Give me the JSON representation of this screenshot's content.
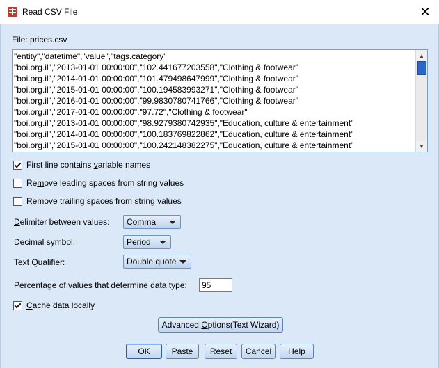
{
  "window": {
    "title": "Read CSV File",
    "close_glyph": "✕"
  },
  "file": {
    "label": "File: prices.csv"
  },
  "preview_lines": [
    "\"entity\",\"datetime\",\"value\",\"tags.category\"",
    "\"boi.org.il\",\"2013-01-01 00:00:00\",\"102.441677203558\",\"Clothing & footwear\"",
    "\"boi.org.il\",\"2014-01-01 00:00:00\",\"101.479498647999\",\"Clothing & footwear\"",
    "\"boi.org.il\",\"2015-01-01 00:00:00\",\"100.194583993271\",\"Clothing & footwear\"",
    "\"boi.org.il\",\"2016-01-01 00:00:00\",\"99.9830780741766\",\"Clothing & footwear\"",
    "\"boi.org.il\",\"2017-01-01 00:00:00\",\"97.72\",\"Clothing & footwear\"",
    "\"boi.org.il\",\"2013-01-01 00:00:00\",\"98.9279380742935\",\"Education, culture & entertainment\"",
    "\"boi.org.il\",\"2014-01-01 00:00:00\",\"100.183769822862\",\"Education, culture & entertainment\"",
    "\"boi.org.il\",\"2015-01-01 00:00:00\",\"100.242148382275\",\"Education, culture & entertainment\""
  ],
  "options": {
    "first_line_names": {
      "label_pre": "First line contains ",
      "label_u": "v",
      "label_post": "ariable names",
      "checked": true
    },
    "remove_leading": {
      "label_pre": "Re",
      "label_u": "m",
      "label_post": "ove leading spaces from string values",
      "checked": false
    },
    "remove_trailing": {
      "label_pre": "Remove trailing spaces from string values",
      "checked": false
    },
    "cache_data": {
      "label_pre": "",
      "label_u": "C",
      "label_post": "ache data locally",
      "checked": true
    }
  },
  "fields": {
    "delimiter": {
      "label_pre": "",
      "label_u": "D",
      "label_post": "elimiter between values:",
      "value": "Comma"
    },
    "decimal": {
      "label_pre": "Decimal ",
      "label_u": "s",
      "label_post": "ymbol:",
      "value": "Period"
    },
    "qualifier": {
      "label_pre": "",
      "label_u": "T",
      "label_post": "ext Qualifier:",
      "value": "Double quote"
    },
    "percentage": {
      "label": "Percentage of values that determine data type:",
      "value": "95"
    }
  },
  "buttons": {
    "advanced_pre": "Advanced ",
    "advanced_u": "O",
    "advanced_post": "ptions(Text Wizard)",
    "ok": "OK",
    "paste": "Paste",
    "reset": "Reset",
    "cancel": "Cancel",
    "help": "Help"
  }
}
